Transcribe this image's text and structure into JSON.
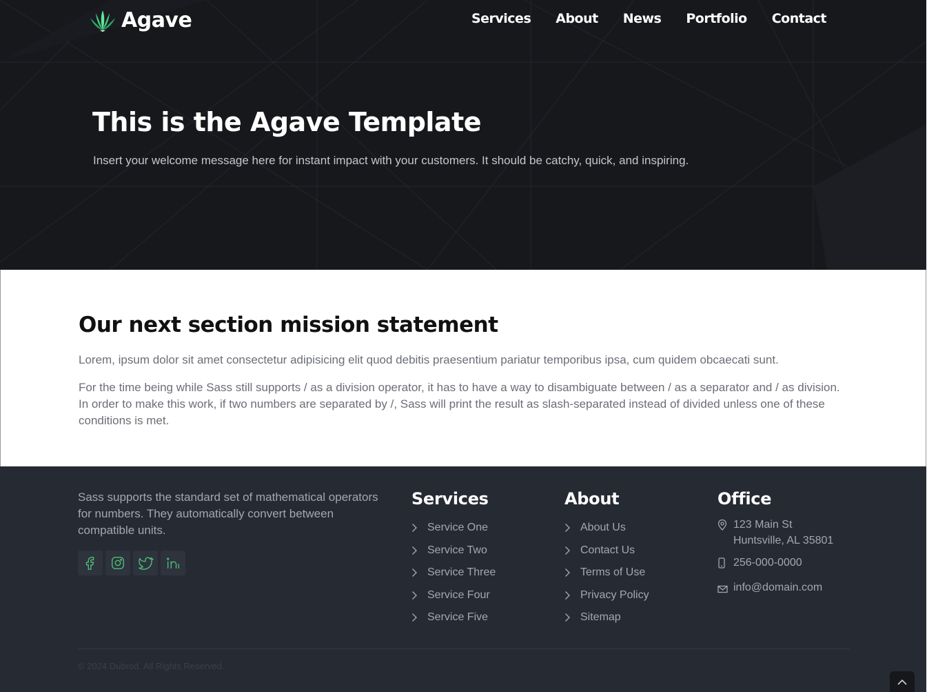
{
  "brand": {
    "name": "Agave",
    "accent": "#4fe08a"
  },
  "nav": {
    "items": [
      {
        "label": "Services"
      },
      {
        "label": "About"
      },
      {
        "label": "News"
      },
      {
        "label": "Portfolio"
      },
      {
        "label": "Contact"
      }
    ]
  },
  "hero": {
    "title": "This is the Agave Template",
    "subtitle": "Insert your welcome message here for instant impact with your customers. It should be catchy, quick, and inspiring."
  },
  "mission": {
    "title": "Our next section mission statement",
    "paragraph1": "Lorem, ipsum dolor sit amet consectetur adipisicing elit quod debitis praesentium pariatur temporibus ipsa, cum quidem obcaecati sunt.",
    "paragraph2": "For the time being while Sass still supports / as a division operator, it has to have a way to disambiguate between / as a separator and / as division. In order to make this work, if two numbers are separated by /, Sass will print the result as slash-separated instead of divided unless one of these conditions is met."
  },
  "footer": {
    "about": "Sass supports the standard set of mathematical operators for numbers. They automatically convert between compatible units.",
    "social": [
      {
        "icon": "facebook-icon"
      },
      {
        "icon": "instagram-icon"
      },
      {
        "icon": "twitter-icon"
      },
      {
        "icon": "linkedin-icon"
      }
    ],
    "services": {
      "title": "Services",
      "items": [
        "Service One",
        "Service Two",
        "Service Three",
        "Service Four",
        "Service Five"
      ]
    },
    "about_col": {
      "title": "About",
      "items": [
        "About Us",
        "Contact Us",
        "Terms of Use",
        "Privacy Policy",
        "Sitemap"
      ]
    },
    "office": {
      "title": "Office",
      "address_line1": "123 Main St",
      "address_line2": "Huntsville, AL 35801",
      "phone": "256-000-0000",
      "email": "info@domain.com"
    },
    "copyright": "© 2024 Dubrod. All Rights Reserved."
  },
  "back_to_top_icon": "chevron-up-icon"
}
